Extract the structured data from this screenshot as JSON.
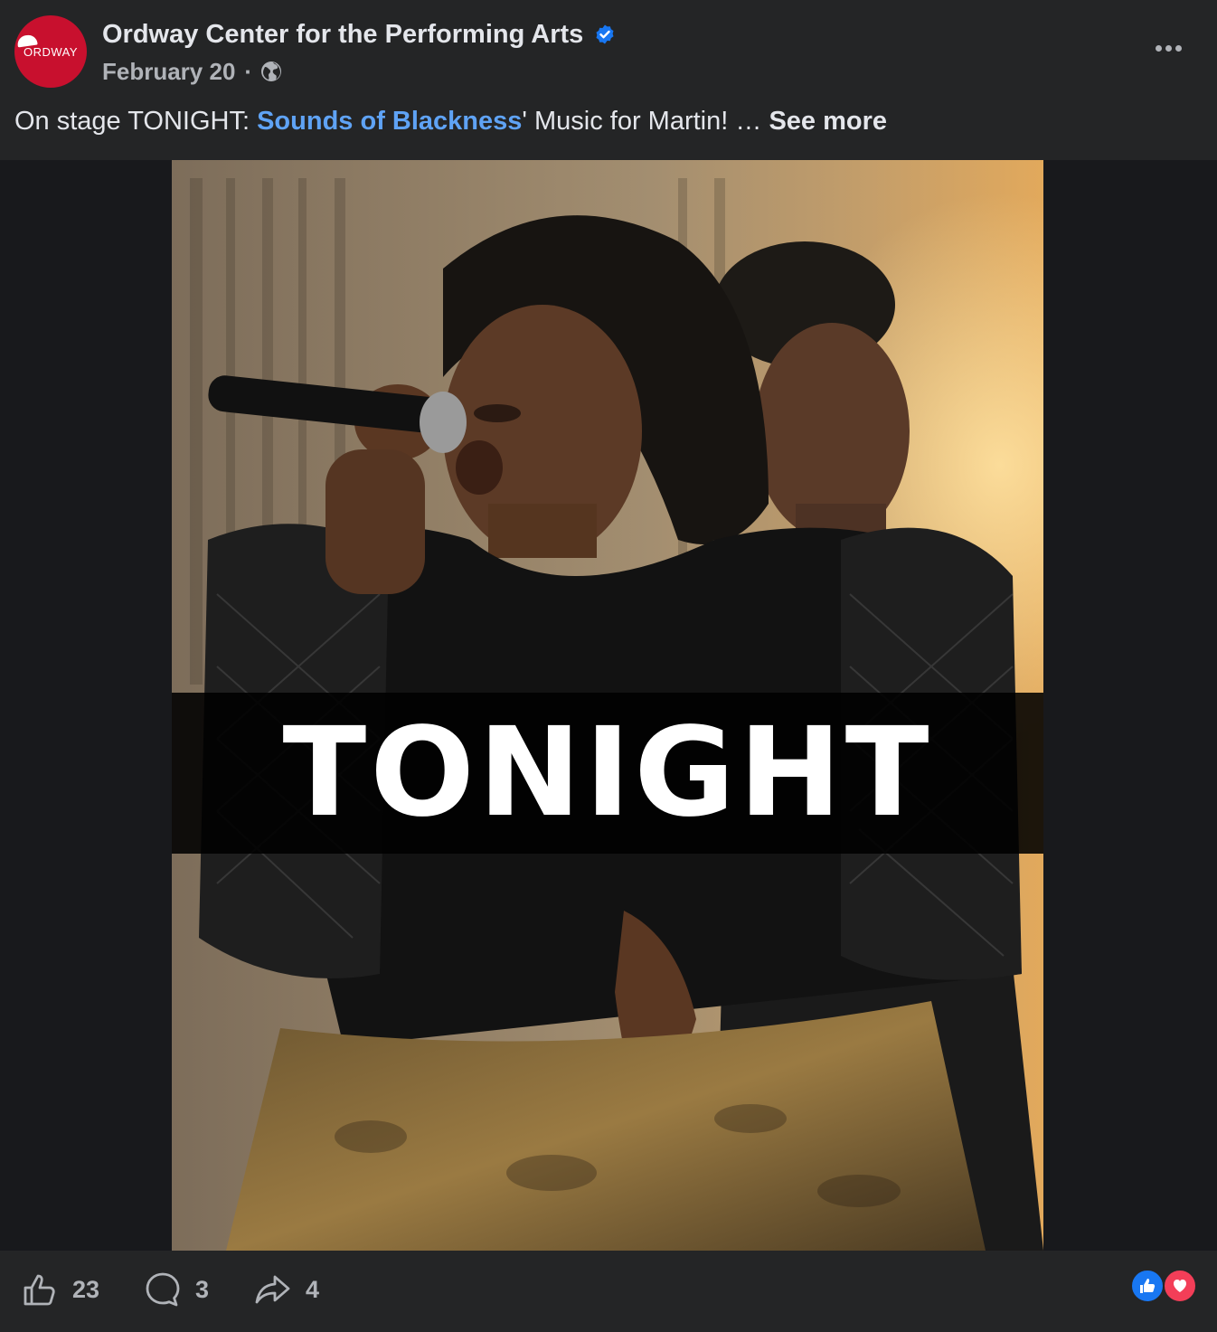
{
  "post": {
    "page_name": "Ordway Center for the Performing Arts",
    "avatar_text": "ORDWAY",
    "date": "February 20",
    "separator": "·",
    "caption": {
      "prefix": "On stage TONIGHT: ",
      "link_text": "Sounds of Blackness",
      "suffix": "' Music for Martin! … ",
      "see_more": "See more"
    },
    "image_banner_text": "TONIGHT"
  },
  "footer": {
    "like_count": "23",
    "comment_count": "3",
    "share_count": "4"
  },
  "icons": {
    "verified": "verified-badge-icon",
    "audience": "globe-icon",
    "more": "more-options-icon",
    "like": "thumbs-up-icon",
    "comment": "comment-icon",
    "share": "share-arrow-icon",
    "reaction_like": "like-reaction-icon",
    "reaction_love": "love-reaction-icon"
  },
  "colors": {
    "background": "#242526",
    "text_primary": "#e4e6eb",
    "text_secondary": "#b0b3b8",
    "link": "#5fa3f5",
    "verified": "#1877f2",
    "brand": "#c8102e",
    "love": "#f33e58"
  }
}
